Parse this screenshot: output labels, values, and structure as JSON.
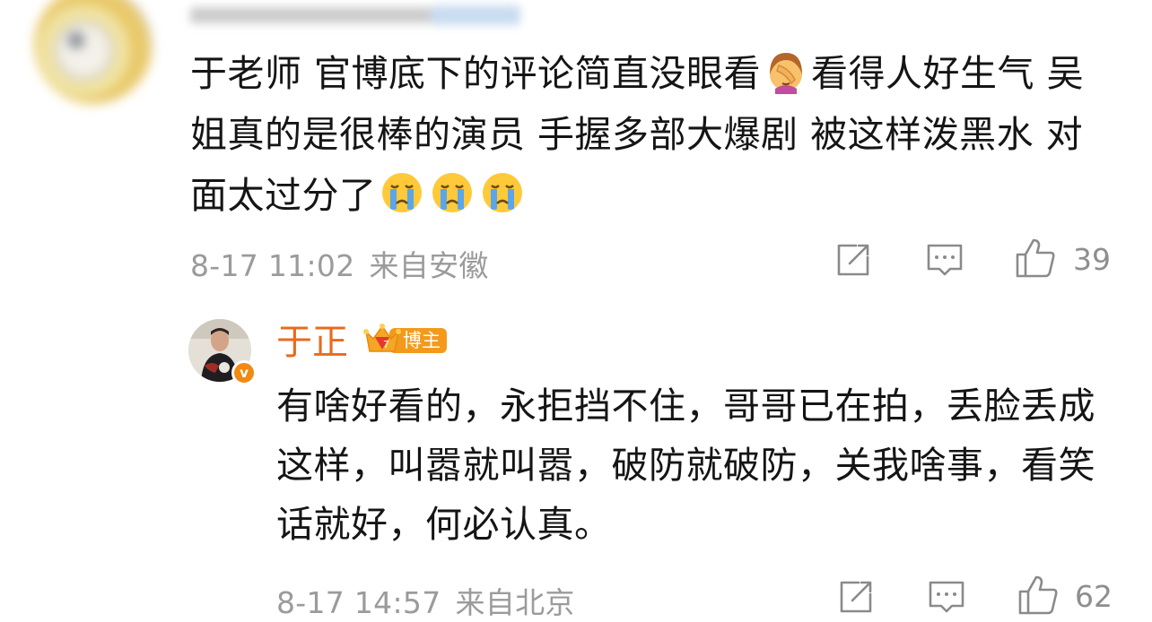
{
  "comment": {
    "text_parts": [
      "于老师 官博底下的评论简直没眼看",
      "看得人好生气 吴姐真的是很棒的演员 手握多部大爆剧 被这样泼黑水 对面太过分了"
    ],
    "emojis": [
      "facepalm-emoji",
      "crying-emoji",
      "crying-emoji",
      "crying-emoji"
    ],
    "timestamp": "8-17 11:02",
    "location": "来自安徽",
    "like_count": "39"
  },
  "reply": {
    "author": "于正",
    "badge_label": "博主",
    "badge_level": "7",
    "verified_mark": "v",
    "text": "有啥好看的，永拒挡不住，哥哥已在拍，丢脸丢成这样，叫嚣就叫嚣，破防就破防，关我啥事，看笑话就好，何必认真。",
    "timestamp": "8-17 14:57",
    "location": "来自北京",
    "like_count": "62"
  },
  "icons": {
    "share": "share-icon",
    "comment": "comment-icon",
    "like": "like-icon"
  },
  "colors": {
    "author_name": "#e86b1e",
    "badge": "#f39a1d",
    "meta_text": "#9b9b9b",
    "icon_stroke": "#8a8a8a"
  }
}
